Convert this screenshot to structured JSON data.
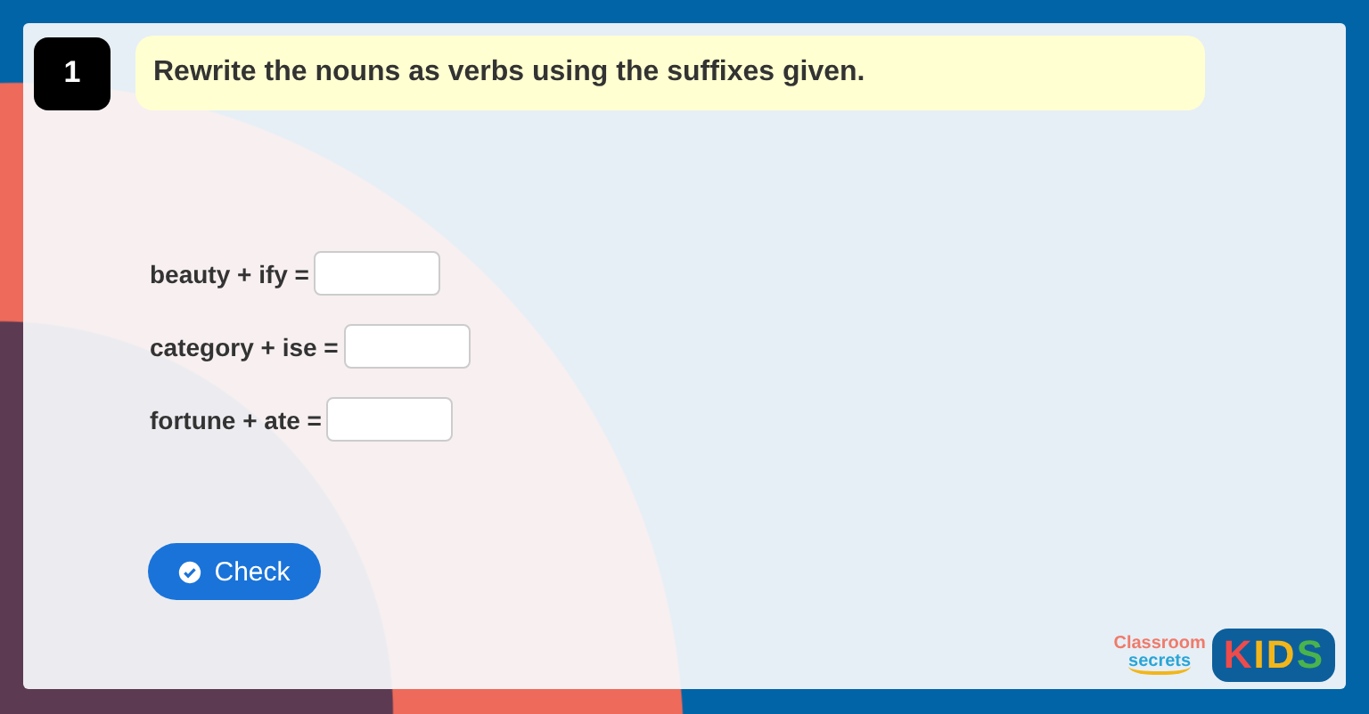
{
  "question": {
    "number": "1",
    "instruction": "Rewrite the nouns as verbs using the suffixes given."
  },
  "items": [
    {
      "label": "beauty + ify ="
    },
    {
      "label": "category + ise ="
    },
    {
      "label": "fortune + ate ="
    }
  ],
  "check_button": {
    "label": "Check"
  },
  "logo": {
    "brand_top": "Classroom",
    "brand_bottom": "secrets",
    "badge": "KIDS"
  }
}
